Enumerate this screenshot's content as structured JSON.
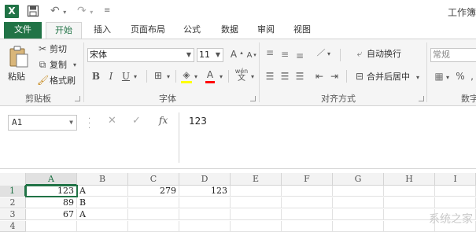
{
  "titlebar": {
    "app_logo": "X",
    "doc_title": "工作簿"
  },
  "tabs": [
    {
      "label": "文件"
    },
    {
      "label": "开始"
    },
    {
      "label": "插入"
    },
    {
      "label": "页面布局"
    },
    {
      "label": "公式"
    },
    {
      "label": "数据"
    },
    {
      "label": "审阅"
    },
    {
      "label": "视图"
    }
  ],
  "ribbon": {
    "clipboard": {
      "paste_label": "粘贴",
      "cut_label": "剪切",
      "copy_label": "复制",
      "format_painter_label": "格式刷",
      "group_label": "剪贴板"
    },
    "font": {
      "font_name": "宋体",
      "font_size": "11",
      "bold": "B",
      "italic": "I",
      "underline": "U",
      "grow": "A",
      "shrink": "A",
      "font_color": "A",
      "phonetic": "wén",
      "group_label": "字体"
    },
    "alignment": {
      "wrap_text_label": "自动换行",
      "merge_center_label": "合并后居中",
      "group_label": "对齐方式"
    },
    "number": {
      "format_value": "常规",
      "percent": "%",
      "group_label": "数字"
    }
  },
  "formula_bar": {
    "name_box": "A1",
    "fx_label": "fx",
    "formula_value": "123"
  },
  "grid": {
    "columns": [
      "A",
      "B",
      "C",
      "D",
      "E",
      "F",
      "G",
      "H",
      "I"
    ],
    "rows": [
      {
        "num": "1",
        "a": "123",
        "b": "A",
        "c": "279",
        "d": "123"
      },
      {
        "num": "2",
        "a": "89",
        "b": "B",
        "c": "",
        "d": ""
      },
      {
        "num": "3",
        "a": "67",
        "b": "A",
        "c": "",
        "d": ""
      },
      {
        "num": "4",
        "a": "",
        "b": "",
        "c": "",
        "d": ""
      }
    ]
  },
  "watermark": "系统之家"
}
